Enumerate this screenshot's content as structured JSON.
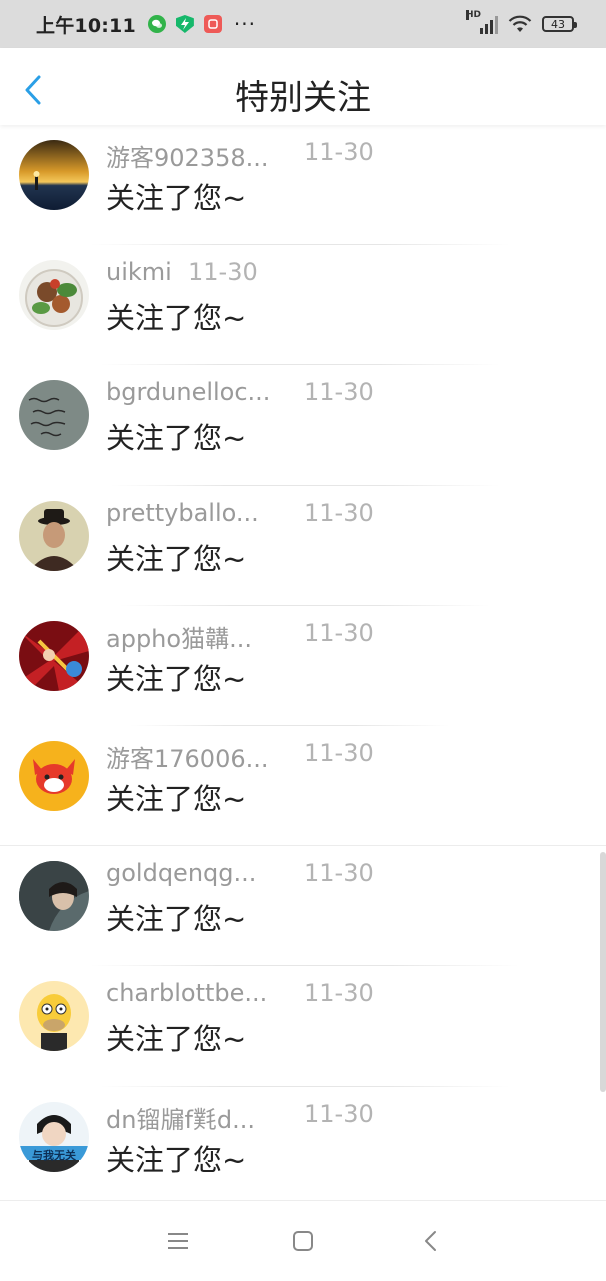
{
  "status_bar": {
    "time": "上午10:11",
    "notif_icons": [
      "wechat-icon",
      "shield-icon",
      "app-icon"
    ],
    "more": "···",
    "battery": "43",
    "signal_label": "HD"
  },
  "header": {
    "title": "特别关注"
  },
  "items": [
    {
      "name": "游客902358...",
      "date": "11-30",
      "message": "关注了您~",
      "avatar": "sunset-avatar"
    },
    {
      "name": "uikmi",
      "date": "11-30",
      "message": "关注了您~",
      "avatar": "food-avatar"
    },
    {
      "name": "bgrdunelloc...",
      "date": "11-30",
      "message": "关注了您~",
      "avatar": "handwriting-avatar"
    },
    {
      "name": "prettyballo...",
      "date": "11-30",
      "message": "关注了您~",
      "avatar": "man-hat-avatar"
    },
    {
      "name": "appho猫韝...",
      "date": "11-30",
      "message": "关注了您~",
      "avatar": "anime-avatar"
    },
    {
      "name": "游客176006...",
      "date": "11-30",
      "message": "关注了您~",
      "avatar": "cartoon-fox-avatar"
    },
    {
      "name": "goldqenqg...",
      "date": "11-30",
      "message": "关注了您~",
      "avatar": "girl-avatar"
    },
    {
      "name": "charblottbe...",
      "date": "11-30",
      "message": "关注了您~",
      "avatar": "homer-avatar"
    },
    {
      "name": "dn镏牖f㲫d...",
      "date": "11-30",
      "message": "关注了您~",
      "avatar": "boy-avatar",
      "avatar_text": "与我无关"
    }
  ],
  "nav": {
    "buttons": [
      "menu-icon",
      "home-icon",
      "back-icon"
    ]
  },
  "colors": {
    "accent": "#2a9fe6",
    "name": "#9a9a9a",
    "date": "#b3b3b3",
    "message": "#222222"
  }
}
